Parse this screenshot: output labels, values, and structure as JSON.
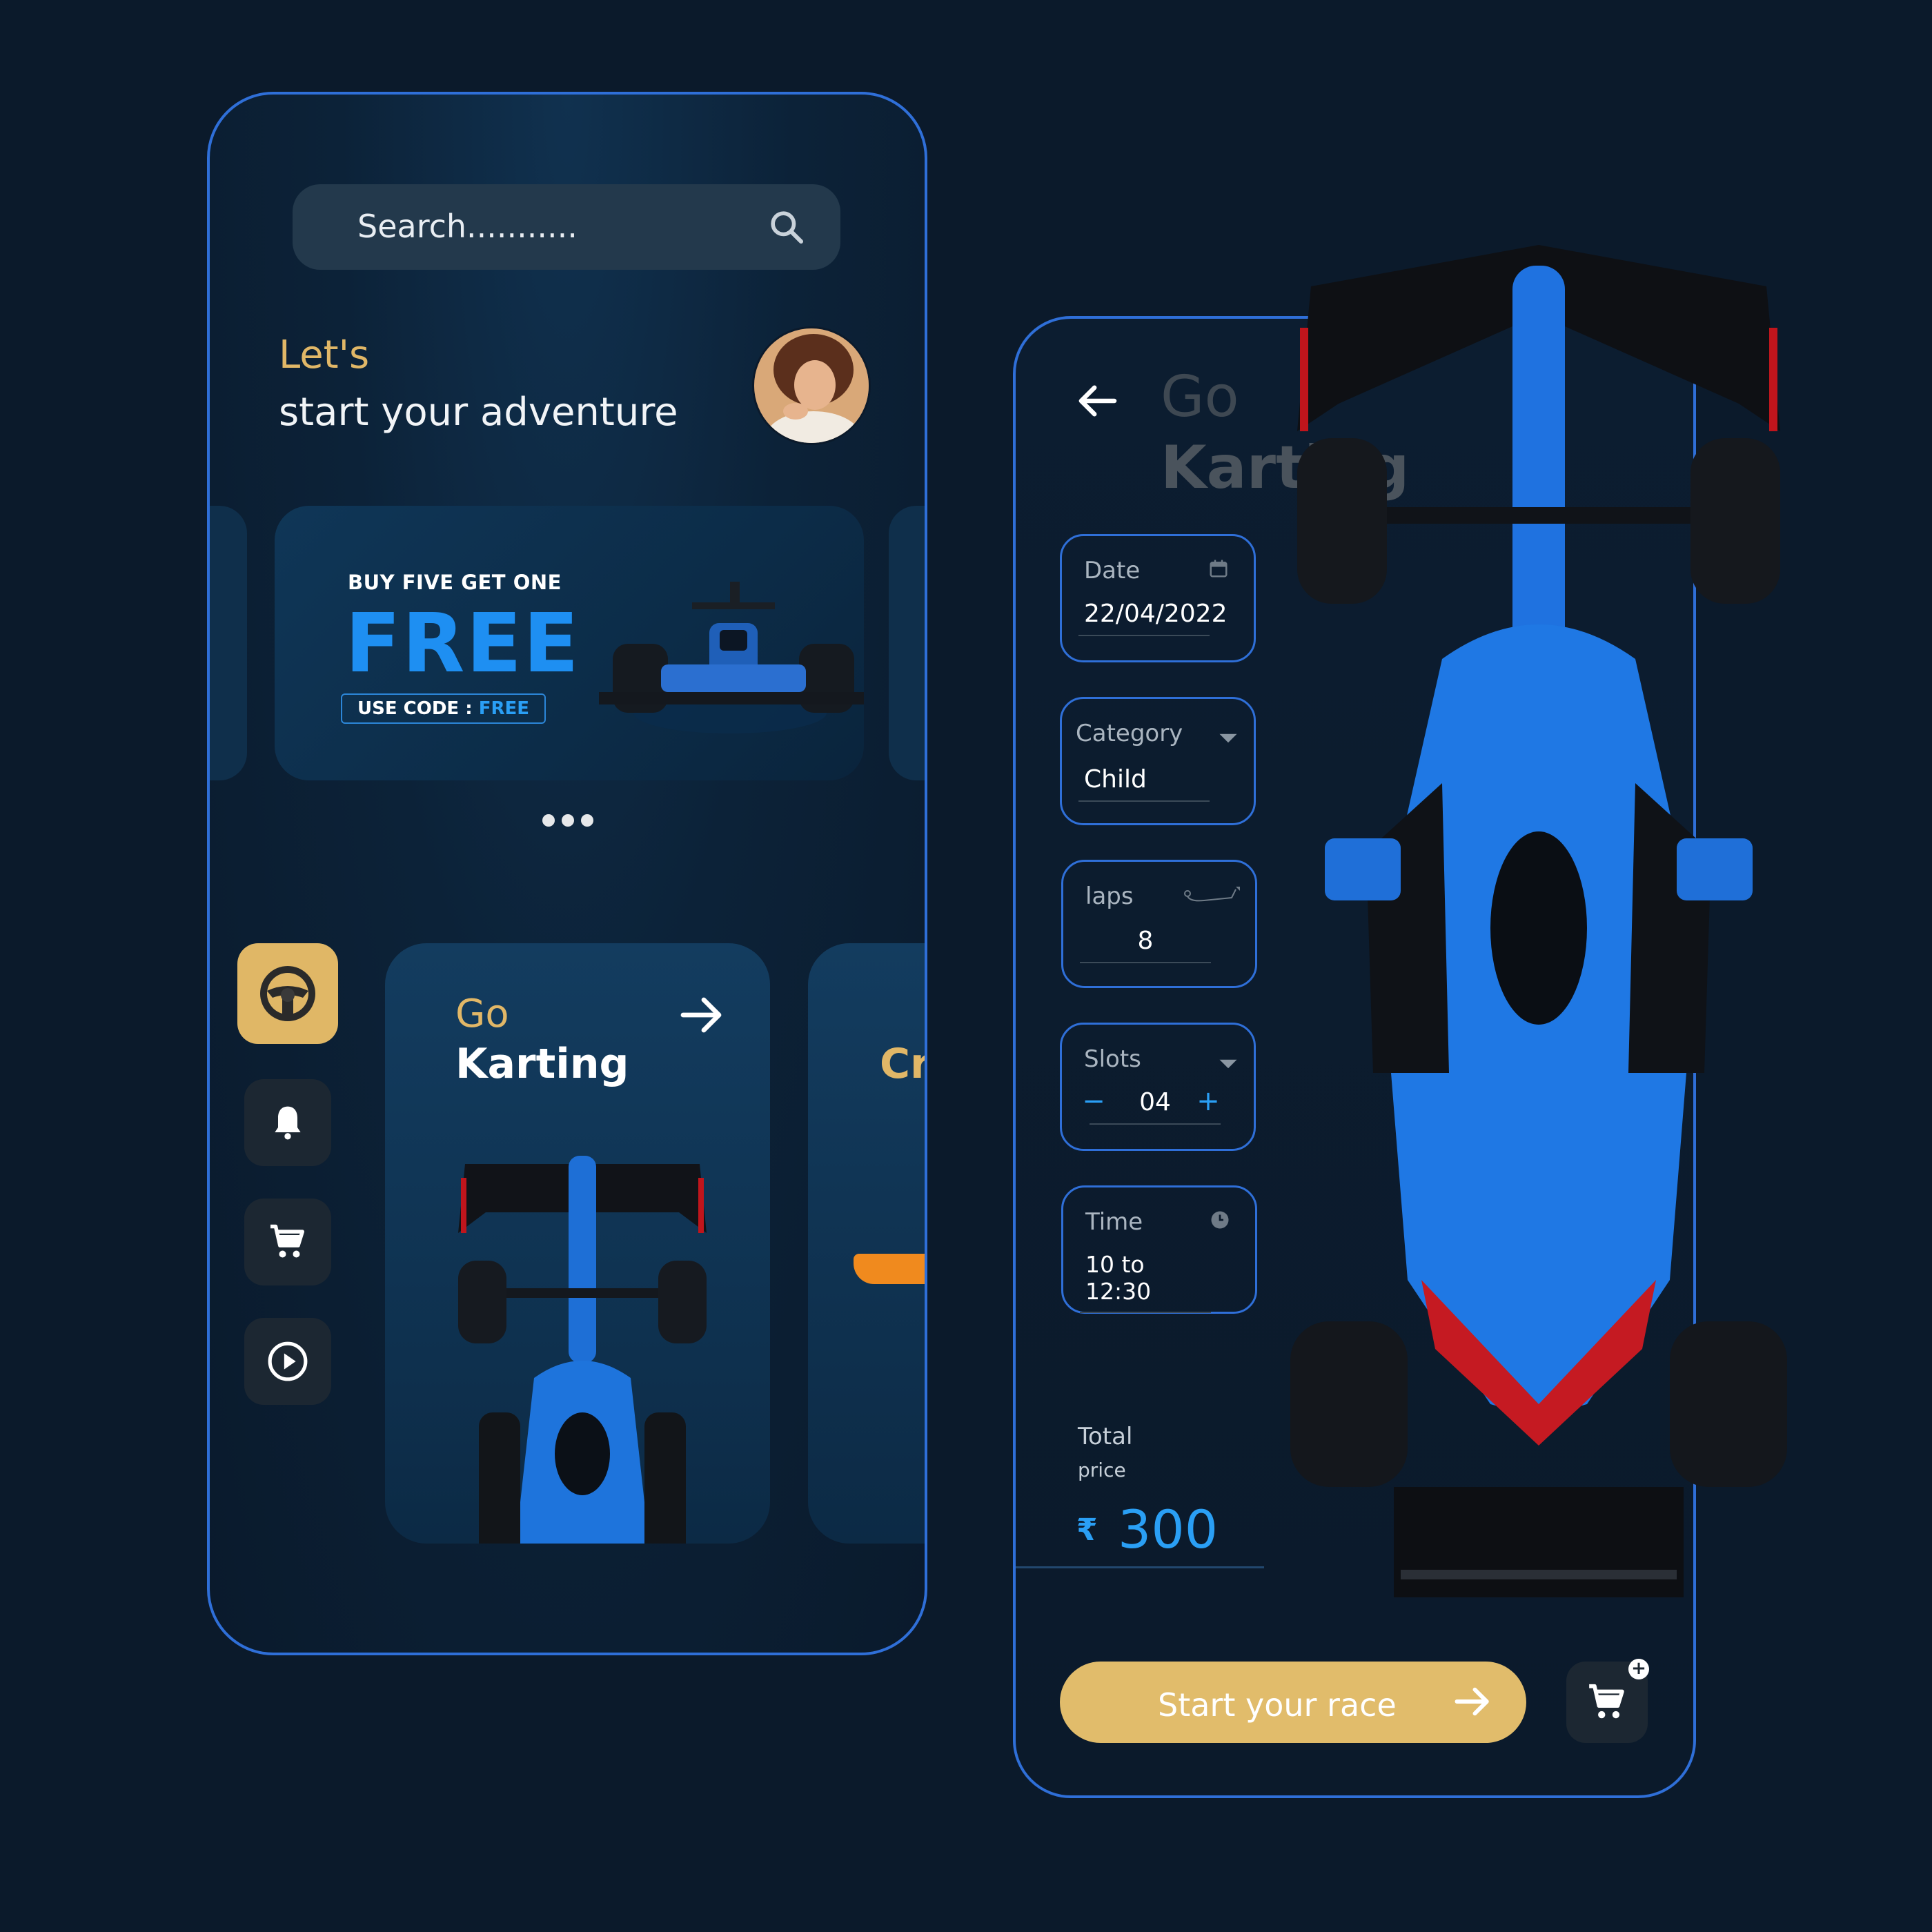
{
  "home": {
    "search_placeholder": "Search...........",
    "greeting_line1": "Let's",
    "greeting_line2": "start your adventure",
    "promo": {
      "eyebrow": "BUY FIVE GET ONE",
      "headline": "FREE",
      "code_prefix": "USE CODE : ",
      "code_value": "FREE"
    },
    "carousel_dots": 3,
    "rail": [
      {
        "icon": "steering-wheel-icon",
        "active": true
      },
      {
        "icon": "bell-icon",
        "active": false
      },
      {
        "icon": "cart-icon",
        "active": false
      },
      {
        "icon": "play-icon",
        "active": false
      }
    ],
    "card": {
      "eyebrow": "Go",
      "title": "Karting"
    },
    "card_peek": {
      "title": "Cr"
    }
  },
  "booking": {
    "title_line1": "Go",
    "title_line2": "Karting",
    "fields": {
      "date": {
        "label": "Date",
        "value": "22/04/2022",
        "icon": "calendar-icon"
      },
      "category": {
        "label": "Category",
        "value": "Child",
        "icon": "chevron-down-icon"
      },
      "laps": {
        "label": "laps",
        "value": "8",
        "icon": "track-icon"
      },
      "slots": {
        "label": "Slots",
        "value": "04",
        "minus": "−",
        "plus": "+",
        "icon": "chevron-down-icon"
      },
      "time": {
        "label": "Time",
        "value": "10 to 12:30",
        "icon": "clock-icon"
      }
    },
    "total_label": "Total",
    "total_sub": "price",
    "currency": "₹",
    "price": "300",
    "cta_label": "Start your race",
    "cart_badge": "+"
  },
  "colors": {
    "background": "#0b1a2b",
    "accent_gold": "#e1b767",
    "accent_blue": "#2a9ff5",
    "border_blue": "#2f6fd8"
  }
}
